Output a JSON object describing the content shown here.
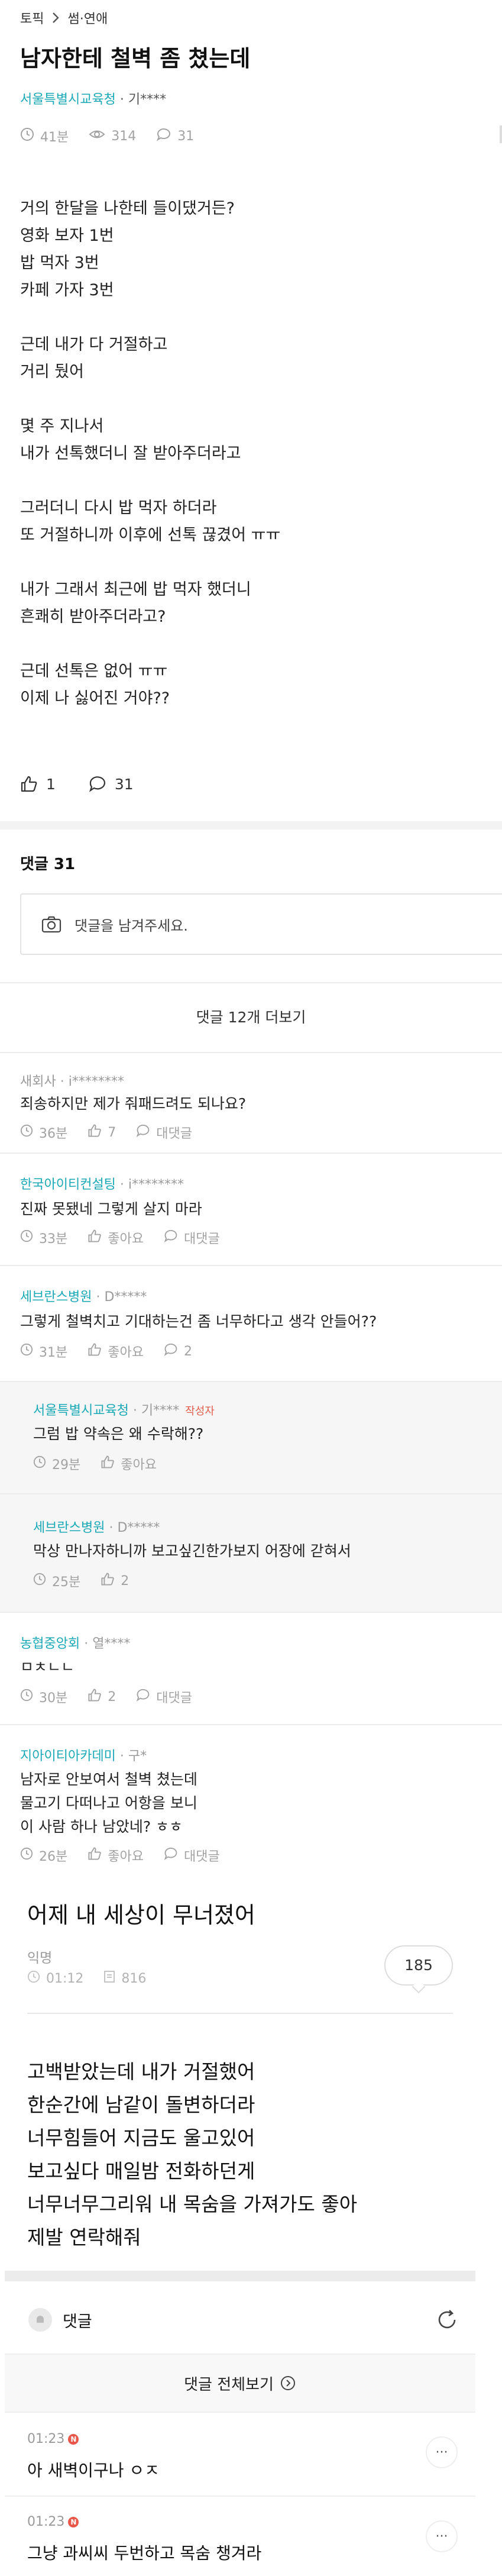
{
  "breadcrumb": {
    "root": "토픽",
    "current": "썸·연애"
  },
  "post": {
    "title": "남자한테 철벽 좀 쳤는데",
    "author_org": "서울특별시교육청",
    "author_name": "· 기****",
    "time": "41분",
    "views": "314",
    "comments_count": "31",
    "paragraphs": [
      [
        "거의 한달을 나한테 들이댔거든?",
        "영화 보자 1번",
        "밥 먹자 3번",
        "카페 가자 3번"
      ],
      [
        "근데 내가 다 거절하고",
        "거리 뒀어"
      ],
      [
        "몇 주 지나서",
        "내가 선톡했더니 잘 받아주더라고"
      ],
      [
        "그러더니 다시 밥 먹자 하더라",
        "또 거절하니까 이후에 선톡 끊겼어 ㅠㅠ"
      ],
      [
        "내가 그래서 최근에 밥 먹자 했더니",
        "흔쾌히 받아주더라고?"
      ],
      [
        "근데 선톡은 없어 ㅠㅠ",
        "이제 나 싫어진 거야??"
      ]
    ],
    "likes": "1",
    "comment_total": "31"
  },
  "comments_section": {
    "heading": "댓글 31",
    "input_placeholder": "댓글을 남겨주세요.",
    "more_label": "댓글 12개 더보기"
  },
  "comments": [
    {
      "org": "새회사",
      "user": "· i********",
      "org_color": "#9a9a9a",
      "text": [
        "죄송하지만 제가 줘패드려도 되나요?"
      ],
      "time": "36분",
      "likes": "7",
      "reply": "대댓글"
    },
    {
      "org": "한국아이티컨설팅",
      "user": "· i********",
      "org_color": "#1aa9b6",
      "text": [
        "진짜 못됐네 그렇게 살지 마라"
      ],
      "time": "33분",
      "likes": "좋아요",
      "reply": "대댓글"
    },
    {
      "org": "세브란스병원",
      "user": "· D*****",
      "org_color": "#1aa9b6",
      "text": [
        "그렇게 철벽치고 기대하는건 좀 너무하다고 생각 안들어??"
      ],
      "time": "31분",
      "likes": "좋아요",
      "reply": "2"
    },
    {
      "org": "서울특별시교육청",
      "user": "· 기****",
      "badge": "작성자",
      "org_color": "#1aa9b6",
      "text": [
        "그럼 밥 약속은 왜 수락해??"
      ],
      "time": "29분",
      "likes": "좋아요"
    },
    {
      "org": "세브란스병원",
      "user": "· D*****",
      "org_color": "#1aa9b6",
      "text": [
        "막상 만나자하니까 보고싶긴한가보지 어장에 갇혀서"
      ],
      "time": "25분",
      "likes": "2"
    },
    {
      "org": "농협중앙회",
      "user": "· 열****",
      "org_color": "#1aa9b6",
      "text": [
        "ㅁㅊㄴㄴ"
      ],
      "time": "30분",
      "likes": "2",
      "reply": "대댓글"
    },
    {
      "org": "지아이티아카데미",
      "user": "· 구*",
      "org_color": "#1aa9b6",
      "text": [
        "남자로 안보여서 철벽 쳤는데",
        "물고기 다떠나고 어항을 보니",
        "이 사람 하나 남았네? ㅎㅎ"
      ],
      "time": "26분",
      "likes": "좋아요",
      "reply": "대댓글"
    }
  ],
  "cafe": {
    "title": "어제 내 세상이 무너졌어",
    "author": "익명",
    "time": "01:12",
    "views": "816",
    "bubble_count": "185",
    "lines": [
      "고백받았는데 내가 거절했어",
      "한순간에 남같이 돌변하더라",
      "너무힘들어 지금도 울고있어",
      "보고싶다 매일밤 전화하던게",
      "너무너무그리워 내 목숨을 가져가도 좋아",
      "제발 연락해줘"
    ],
    "comment_label": "댓글",
    "view_all_label": "댓글 전체보기",
    "new_badge": "N",
    "comments": [
      {
        "time": "01:23",
        "text": "아 새벽이구나 ㅇㅈ"
      },
      {
        "time": "01:23",
        "text": "그냥 과씨씨 두번하고 목숨 챙겨라"
      }
    ]
  }
}
